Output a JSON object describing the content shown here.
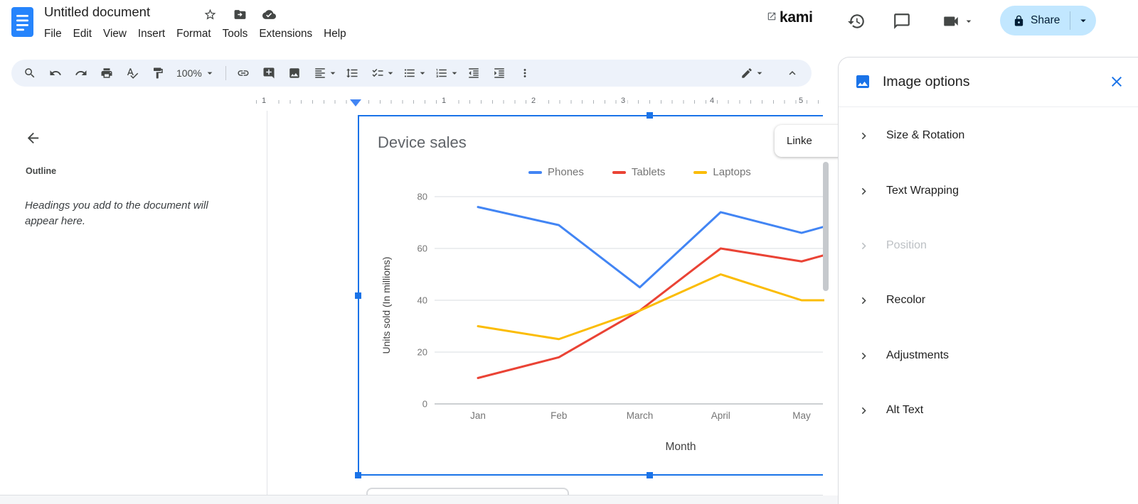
{
  "header": {
    "title": "Untitled document",
    "menus": [
      "File",
      "Edit",
      "View",
      "Insert",
      "Format",
      "Tools",
      "Extensions",
      "Help"
    ],
    "kami": "kami",
    "share": "Share"
  },
  "toolbar": {
    "zoom": "100%"
  },
  "outline_panel": {
    "title": "Outline",
    "empty_message": "Headings you add to the document will appear here."
  },
  "ruler_numbers": [
    "1",
    "1",
    "2",
    "3",
    "4",
    "5"
  ],
  "linked_chart": {
    "label": "Linke"
  },
  "panel": {
    "title": "Image options",
    "items": [
      {
        "label": "Size & Rotation",
        "disabled": false
      },
      {
        "label": "Text Wrapping",
        "disabled": false
      },
      {
        "label": "Position",
        "disabled": true
      },
      {
        "label": "Recolor",
        "disabled": false
      },
      {
        "label": "Adjustments",
        "disabled": false
      },
      {
        "label": "Alt Text",
        "disabled": false
      }
    ]
  },
  "icons": [
    "docs-logo",
    "star-icon",
    "move-folder-icon",
    "cloud-status-icon",
    "external-link-icon",
    "history-icon",
    "comments-icon",
    "video-call-icon",
    "dropdown-arrow-icon",
    "lock-icon",
    "search-icon",
    "undo-icon",
    "redo-icon",
    "print-icon",
    "spellcheck-icon",
    "paint-format-icon",
    "link-icon",
    "add-comment-icon",
    "insert-image-icon",
    "align-icon",
    "line-spacing-icon",
    "checklist-icon",
    "bulleted-list-icon",
    "numbered-list-icon",
    "decrease-indent-icon",
    "increase-indent-icon",
    "more-icon",
    "edit-mode-icon",
    "collapse-toolbar-icon",
    "image-icon",
    "close-icon",
    "chevron-right-icon",
    "back-arrow-icon"
  ],
  "chart_data": {
    "type": "line",
    "title": "Device sales",
    "xlabel": "Month",
    "ylabel": "Units sold (In millions)",
    "categories": [
      "Jan",
      "Feb",
      "March",
      "April",
      "May"
    ],
    "series": [
      {
        "name": "Phones",
        "color": "#4285f4",
        "values": [
          76,
          69,
          45,
          74,
          66
        ],
        "value_at_clip_edge": 68.5
      },
      {
        "name": "Tablets",
        "color": "#ea4335",
        "values": [
          10,
          18,
          36,
          60,
          55
        ],
        "value_at_clip_edge": 57.5
      },
      {
        "name": "Laptops",
        "color": "#fbbc04",
        "values": [
          30,
          25,
          36,
          50,
          40
        ],
        "value_at_clip_edge": 40
      }
    ],
    "ylim": [
      0,
      80
    ],
    "yticks": [
      0,
      20,
      40,
      60,
      80
    ],
    "grid": true,
    "legend_position": "top"
  }
}
